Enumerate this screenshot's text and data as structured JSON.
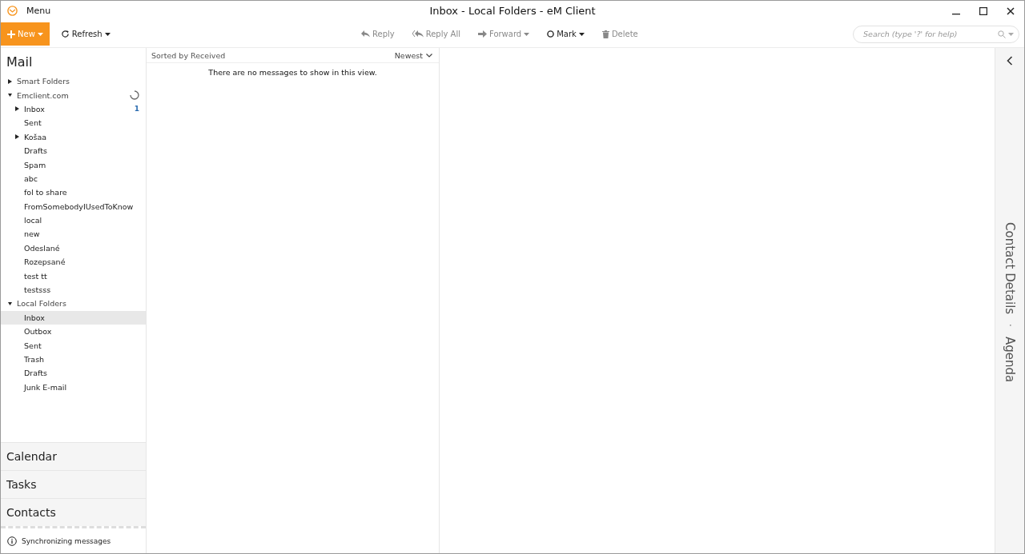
{
  "window": {
    "title": "Inbox - Local Folders - eM Client",
    "menu": "Menu"
  },
  "toolbar": {
    "left": [
      {
        "label": "New",
        "kind": "primary",
        "dropdown": true,
        "disabled": false
      },
      {
        "label": "Refresh",
        "kind": "refresh",
        "dropdown": true,
        "disabled": false
      }
    ],
    "center": [
      {
        "label": "Reply",
        "kind": "reply",
        "dropdown": false,
        "disabled": true
      },
      {
        "label": "Reply All",
        "kind": "replyall",
        "dropdown": false,
        "disabled": true
      },
      {
        "label": "Forward",
        "kind": "forward",
        "dropdown": true,
        "disabled": true
      },
      {
        "label": "Mark",
        "kind": "mark",
        "dropdown": true,
        "disabled": false
      },
      {
        "label": "Delete",
        "kind": "delete",
        "dropdown": false,
        "disabled": true
      }
    ],
    "search": {
      "placeholder": "Search (type '?' for help)"
    }
  },
  "sidebar": {
    "title": "Mail",
    "tree": [
      {
        "label": "Smart Folders",
        "expanded": false,
        "hasChildren": true,
        "selected": false
      },
      {
        "label": "Emclient.com",
        "expanded": true,
        "selected": false,
        "loading": true,
        "children": [
          {
            "label": "Inbox",
            "expanded": false,
            "hasChildren": true,
            "selected": false,
            "count": "1"
          },
          {
            "label": "Sent",
            "selected": false
          },
          {
            "label": "Košaa",
            "expanded": false,
            "hasChildren": true,
            "selected": false
          },
          {
            "label": "Drafts",
            "selected": false
          },
          {
            "label": "Spam",
            "selected": false
          },
          {
            "label": "abc",
            "selected": false
          },
          {
            "label": "fol to share",
            "selected": false
          },
          {
            "label": "FromSomebodyIUsedToKnow",
            "selected": false
          },
          {
            "label": "local",
            "selected": false
          },
          {
            "label": "new",
            "selected": false
          },
          {
            "label": "Odeslané",
            "selected": false
          },
          {
            "label": "Rozepsané",
            "selected": false
          },
          {
            "label": "test tt",
            "selected": false
          },
          {
            "label": "testsss",
            "selected": false
          }
        ]
      },
      {
        "label": "Local Folders",
        "expanded": true,
        "selected": false,
        "children": [
          {
            "label": "Inbox",
            "selected": true
          },
          {
            "label": "Outbox",
            "selected": false
          },
          {
            "label": "Sent",
            "selected": false
          },
          {
            "label": "Trash",
            "selected": false
          },
          {
            "label": "Drafts",
            "selected": false
          },
          {
            "label": "Junk E-mail",
            "selected": false
          }
        ]
      }
    ],
    "modules": [
      "Calendar",
      "Tasks",
      "Contacts"
    ],
    "status": "Synchronizing messages"
  },
  "message_list": {
    "sort": "Sorted by Received",
    "order": "Newest",
    "empty": "There are no messages to show in this view."
  },
  "right_panel": {
    "tabs": [
      "Contact Details",
      "·",
      "Agenda"
    ]
  }
}
